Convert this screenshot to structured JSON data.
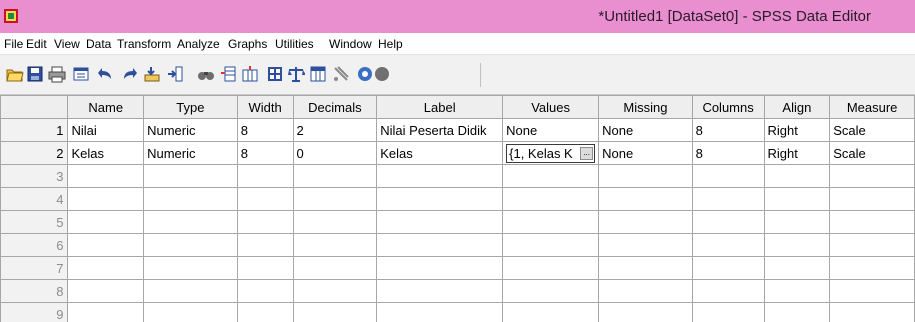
{
  "window": {
    "title": "*Untitled1 [DataSet0] - SPSS Data Editor"
  },
  "menu": [
    "File",
    "Edit",
    "View",
    "Data",
    "Transform",
    "Analyze",
    "Graphs",
    "Utilities",
    "Window",
    "Help"
  ],
  "toolbar": {
    "icons": [
      "open-icon",
      "save-icon",
      "print-icon",
      "dialog-recall-icon",
      "undo-icon",
      "redo-icon",
      "goto-case-icon",
      "goto-variable-icon",
      "find-icon",
      "insert-cases-icon",
      "insert-variable-icon",
      "split-file-icon",
      "weight-cases-icon",
      "select-cases-icon",
      "value-labels-icon",
      "use-sets-icon",
      "show-all-icon"
    ]
  },
  "grid": {
    "columns": [
      "Name",
      "Type",
      "Width",
      "Decimals",
      "Label",
      "Values",
      "Missing",
      "Columns",
      "Align",
      "Measure"
    ],
    "rows": [
      {
        "num": "1",
        "name": "Nilai",
        "type": "Numeric",
        "width": "8",
        "decimals": "2",
        "label": "Nilai Peserta Didik",
        "values": "None",
        "missing": "None",
        "columns": "8",
        "align": "Right",
        "measure": "Scale"
      },
      {
        "num": "2",
        "name": "Kelas",
        "type": "Numeric",
        "width": "8",
        "decimals": "0",
        "label": "Kelas",
        "values": "{1, Kelas K",
        "missing": "None",
        "columns": "8",
        "align": "Right",
        "measure": "Scale"
      }
    ],
    "empty_rows": [
      "3",
      "4",
      "5",
      "6",
      "7",
      "8",
      "9"
    ],
    "ellipsis": "..."
  }
}
